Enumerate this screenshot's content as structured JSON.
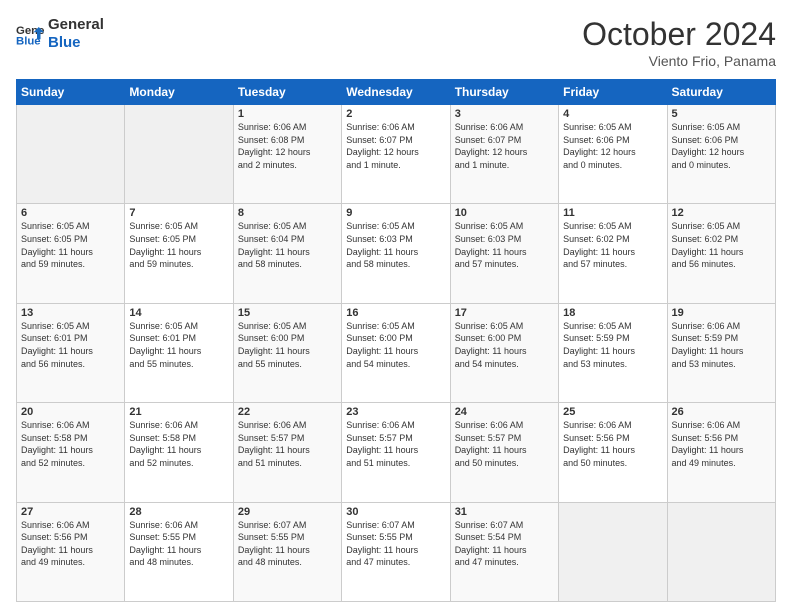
{
  "logo": {
    "line1": "General",
    "line2": "Blue"
  },
  "title": "October 2024",
  "subtitle": "Viento Frio, Panama",
  "days_of_week": [
    "Sunday",
    "Monday",
    "Tuesday",
    "Wednesday",
    "Thursday",
    "Friday",
    "Saturday"
  ],
  "weeks": [
    [
      {
        "day": "",
        "info": ""
      },
      {
        "day": "",
        "info": ""
      },
      {
        "day": "1",
        "info": "Sunrise: 6:06 AM\nSunset: 6:08 PM\nDaylight: 12 hours\nand 2 minutes."
      },
      {
        "day": "2",
        "info": "Sunrise: 6:06 AM\nSunset: 6:07 PM\nDaylight: 12 hours\nand 1 minute."
      },
      {
        "day": "3",
        "info": "Sunrise: 6:06 AM\nSunset: 6:07 PM\nDaylight: 12 hours\nand 1 minute."
      },
      {
        "day": "4",
        "info": "Sunrise: 6:05 AM\nSunset: 6:06 PM\nDaylight: 12 hours\nand 0 minutes."
      },
      {
        "day": "5",
        "info": "Sunrise: 6:05 AM\nSunset: 6:06 PM\nDaylight: 12 hours\nand 0 minutes."
      }
    ],
    [
      {
        "day": "6",
        "info": "Sunrise: 6:05 AM\nSunset: 6:05 PM\nDaylight: 11 hours\nand 59 minutes."
      },
      {
        "day": "7",
        "info": "Sunrise: 6:05 AM\nSunset: 6:05 PM\nDaylight: 11 hours\nand 59 minutes."
      },
      {
        "day": "8",
        "info": "Sunrise: 6:05 AM\nSunset: 6:04 PM\nDaylight: 11 hours\nand 58 minutes."
      },
      {
        "day": "9",
        "info": "Sunrise: 6:05 AM\nSunset: 6:03 PM\nDaylight: 11 hours\nand 58 minutes."
      },
      {
        "day": "10",
        "info": "Sunrise: 6:05 AM\nSunset: 6:03 PM\nDaylight: 11 hours\nand 57 minutes."
      },
      {
        "day": "11",
        "info": "Sunrise: 6:05 AM\nSunset: 6:02 PM\nDaylight: 11 hours\nand 57 minutes."
      },
      {
        "day": "12",
        "info": "Sunrise: 6:05 AM\nSunset: 6:02 PM\nDaylight: 11 hours\nand 56 minutes."
      }
    ],
    [
      {
        "day": "13",
        "info": "Sunrise: 6:05 AM\nSunset: 6:01 PM\nDaylight: 11 hours\nand 56 minutes."
      },
      {
        "day": "14",
        "info": "Sunrise: 6:05 AM\nSunset: 6:01 PM\nDaylight: 11 hours\nand 55 minutes."
      },
      {
        "day": "15",
        "info": "Sunrise: 6:05 AM\nSunset: 6:00 PM\nDaylight: 11 hours\nand 55 minutes."
      },
      {
        "day": "16",
        "info": "Sunrise: 6:05 AM\nSunset: 6:00 PM\nDaylight: 11 hours\nand 54 minutes."
      },
      {
        "day": "17",
        "info": "Sunrise: 6:05 AM\nSunset: 6:00 PM\nDaylight: 11 hours\nand 54 minutes."
      },
      {
        "day": "18",
        "info": "Sunrise: 6:05 AM\nSunset: 5:59 PM\nDaylight: 11 hours\nand 53 minutes."
      },
      {
        "day": "19",
        "info": "Sunrise: 6:06 AM\nSunset: 5:59 PM\nDaylight: 11 hours\nand 53 minutes."
      }
    ],
    [
      {
        "day": "20",
        "info": "Sunrise: 6:06 AM\nSunset: 5:58 PM\nDaylight: 11 hours\nand 52 minutes."
      },
      {
        "day": "21",
        "info": "Sunrise: 6:06 AM\nSunset: 5:58 PM\nDaylight: 11 hours\nand 52 minutes."
      },
      {
        "day": "22",
        "info": "Sunrise: 6:06 AM\nSunset: 5:57 PM\nDaylight: 11 hours\nand 51 minutes."
      },
      {
        "day": "23",
        "info": "Sunrise: 6:06 AM\nSunset: 5:57 PM\nDaylight: 11 hours\nand 51 minutes."
      },
      {
        "day": "24",
        "info": "Sunrise: 6:06 AM\nSunset: 5:57 PM\nDaylight: 11 hours\nand 50 minutes."
      },
      {
        "day": "25",
        "info": "Sunrise: 6:06 AM\nSunset: 5:56 PM\nDaylight: 11 hours\nand 50 minutes."
      },
      {
        "day": "26",
        "info": "Sunrise: 6:06 AM\nSunset: 5:56 PM\nDaylight: 11 hours\nand 49 minutes."
      }
    ],
    [
      {
        "day": "27",
        "info": "Sunrise: 6:06 AM\nSunset: 5:56 PM\nDaylight: 11 hours\nand 49 minutes."
      },
      {
        "day": "28",
        "info": "Sunrise: 6:06 AM\nSunset: 5:55 PM\nDaylight: 11 hours\nand 48 minutes."
      },
      {
        "day": "29",
        "info": "Sunrise: 6:07 AM\nSunset: 5:55 PM\nDaylight: 11 hours\nand 48 minutes."
      },
      {
        "day": "30",
        "info": "Sunrise: 6:07 AM\nSunset: 5:55 PM\nDaylight: 11 hours\nand 47 minutes."
      },
      {
        "day": "31",
        "info": "Sunrise: 6:07 AM\nSunset: 5:54 PM\nDaylight: 11 hours\nand 47 minutes."
      },
      {
        "day": "",
        "info": ""
      },
      {
        "day": "",
        "info": ""
      }
    ]
  ]
}
